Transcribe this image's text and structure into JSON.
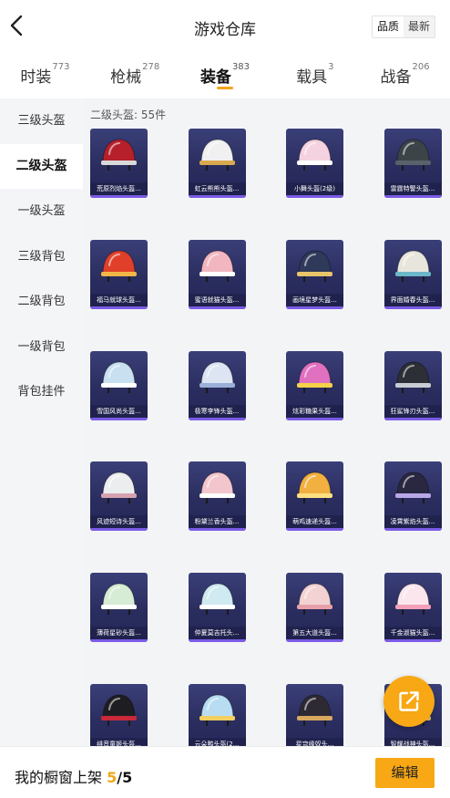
{
  "header": {
    "title": "游戏仓库",
    "back_icon": "chevron-left-icon",
    "sort_options": [
      "品质",
      "最新"
    ],
    "active_sort": "品质"
  },
  "tabs": [
    {
      "label": "时装",
      "count": "773"
    },
    {
      "label": "枪械",
      "count": "278"
    },
    {
      "label": "装备",
      "count": "383"
    },
    {
      "label": "载具",
      "count": "3"
    },
    {
      "label": "战备",
      "count": "206"
    }
  ],
  "active_tab": "装备",
  "sidebar": {
    "items": [
      "三级头盔",
      "二级头盔",
      "一级头盔",
      "三级背包",
      "二级背包",
      "一级背包",
      "背包挂件"
    ],
    "active": "二级头盔"
  },
  "content": {
    "section_title": "二级头盔: 55件",
    "items": [
      {
        "name": "荒原烈焰头盔...",
        "color": "#b5202a",
        "accent": "#d9d9d9"
      },
      {
        "name": "虹云熊熊头盔...",
        "color": "#f0f0f0",
        "accent": "#d8a850"
      },
      {
        "name": "小舞头盔(2级)",
        "color": "#f5d2e0",
        "accent": "#ffffff"
      },
      {
        "name": "雷霆特警头盔...",
        "color": "#3d4447",
        "accent": "#58626a"
      },
      {
        "name": "福马就球头盔...",
        "color": "#e0402a",
        "accent": "#f2b648"
      },
      {
        "name": "蜜语就猫头盔...",
        "color": "#f2b6c0",
        "accent": "#ffffff"
      },
      {
        "name": "画境星梦头盔...",
        "color": "#2f3a5a",
        "accent": "#e8c56a"
      },
      {
        "name": "界面婚春头盔...",
        "color": "#e8e6dc",
        "accent": "#6cb8c8"
      },
      {
        "name": "雪国风尚头盔...",
        "color": "#c8e0f0",
        "accent": "#ffffff"
      },
      {
        "name": "极寒李锋头盔...",
        "color": "#dde4f2",
        "accent": "#9ab0d8"
      },
      {
        "name": "炫彩糖果头盔...",
        "color": "#e070c0",
        "accent": "#f6d24a"
      },
      {
        "name": "狂鲨锋刃头盔...",
        "color": "#2c2f36",
        "accent": "#c8ccd4"
      },
      {
        "name": "风迹短诗头盔...",
        "color": "#ecedef",
        "accent": "#d6a2b0"
      },
      {
        "name": "粉黛兰香头盔...",
        "color": "#f2c6cc",
        "accent": "#ffffff"
      },
      {
        "name": "萌鸡速递头盔...",
        "color": "#f2b040",
        "accent": "#ffe080"
      },
      {
        "name": "凌霄紫焰头盔...",
        "color": "#2a2840",
        "accent": "#b8a8e8"
      },
      {
        "name": "薄荷星砂头盔...",
        "color": "#d6ecd4",
        "accent": "#ffffff"
      },
      {
        "name": "仲夏莫吉托头...",
        "color": "#cfeaf0",
        "accent": "#ffffff"
      },
      {
        "name": "第五大道头盔...",
        "color": "#f2d2d2",
        "accent": "#e8a0a8"
      },
      {
        "name": "千金淑猫头盔...",
        "color": "#fbe6ee",
        "accent": "#f2a0b8"
      },
      {
        "name": "绯音童姬头盔...",
        "color": "#1e1e22",
        "accent": "#c8283a"
      },
      {
        "name": "云朵鸭头盔(2...",
        "color": "#b8ddf2",
        "accent": "#f2d060"
      },
      {
        "name": "星穹缘奴头...",
        "color": "#2e2a34",
        "accent": "#d8a860"
      },
      {
        "name": "智耀战神头盔...",
        "color": "#2a2c30",
        "accent": "#f2c060"
      }
    ]
  },
  "fab": {
    "icon": "share-external-icon"
  },
  "bottom": {
    "showcase_label": "我的橱窗上架",
    "showcase_count": "5",
    "showcase_total": "/5",
    "edit_label": "编辑"
  },
  "colors": {
    "accent": "#f7a814",
    "card_bg": "#2a2d5e",
    "card_strip": "#7b5be6",
    "sidebar_bg": "#f4f5f7"
  }
}
